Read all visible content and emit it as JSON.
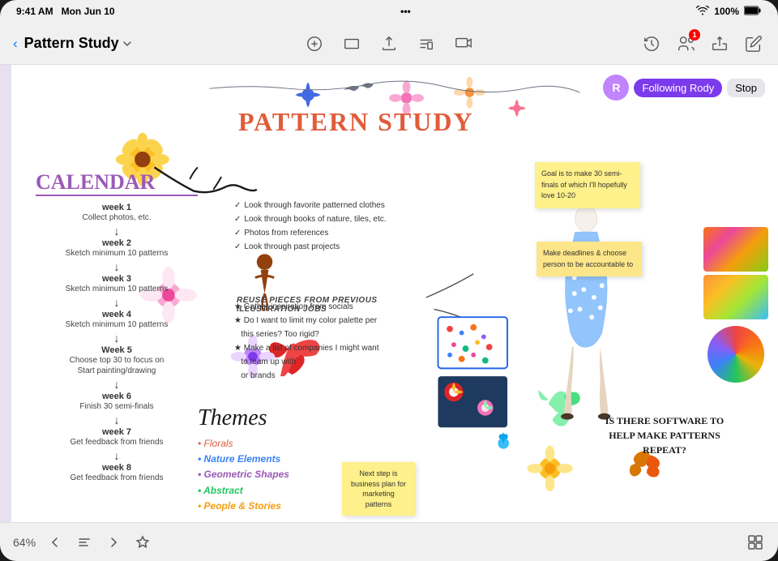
{
  "statusBar": {
    "time": "9:41 AM",
    "day": "Mon Jun 10",
    "signal": "●●●",
    "wifi": "WiFi",
    "battery": "100%"
  },
  "toolbar": {
    "backLabel": "‹",
    "docTitle": "Pattern Study",
    "dropdownIcon": "chevron-down",
    "centerIcons": [
      "circle-a",
      "rectangle-fill",
      "arrow-up-doc",
      "textformat",
      "photo-film"
    ],
    "rightIcons": [
      "clock.arrow",
      "person-badge",
      "square-arrow-up",
      "pencil"
    ]
  },
  "followingBadge": {
    "avatarLetter": "R",
    "label": "Following Rody",
    "stopLabel": "Stop"
  },
  "canvas": {
    "mainTitle": "PATTERN STUDY",
    "calendarTitle": "CALENDAR",
    "weeks": [
      {
        "label": "week 1",
        "desc": "Collect photos, etc."
      },
      {
        "label": "week 2",
        "desc": "Sketch minimum 10 patterns"
      },
      {
        "label": "week 3",
        "desc": "Sketch minimum 10 patterns"
      },
      {
        "label": "week 4",
        "desc": "Sketch minimum 10 patterns"
      },
      {
        "label": "Week 5",
        "desc": "Choose top 30 to focus on\nStart painting/drawing"
      },
      {
        "label": "week 6",
        "desc": "Finish 30 semi-finals"
      },
      {
        "label": "week 7",
        "desc": "Get feedback from friends"
      },
      {
        "label": "week 8",
        "desc": "Get feedback from friends"
      }
    ],
    "bulletNotes": [
      "Look through favorite patterned clothes",
      "Look through books of nature, tiles, etc.",
      "Photos from references",
      "Look through past projects"
    ],
    "middleNotes": [
      "Reuse pieces from previous illustration jobs",
      "Gather inspiration from socials",
      "Do I want to limit my color palette per this series? Too rigid?",
      "Make a list of companies I might want to team up with",
      "or brands"
    ],
    "stickyGoal": "Goal is to make 30 semi-finals of which I'll hopefully love 10-20",
    "stickyDeadline": "Make deadlines & choose person to be accountable to",
    "bizNote": "Next step is business plan for marketing patterns",
    "themesTitle": "Themes",
    "themes": [
      "• Florals",
      "• Nature Elements",
      "• Geometric Shapes",
      "• Abstract",
      "• People & Stories"
    ],
    "rightQuestion": "Is there software to help make patterns repeat?"
  },
  "bottomBar": {
    "zoom": "64%",
    "icons": [
      "chevron-left",
      "list-bullet",
      "chevron-right",
      "star"
    ],
    "rightIcon": "square"
  }
}
